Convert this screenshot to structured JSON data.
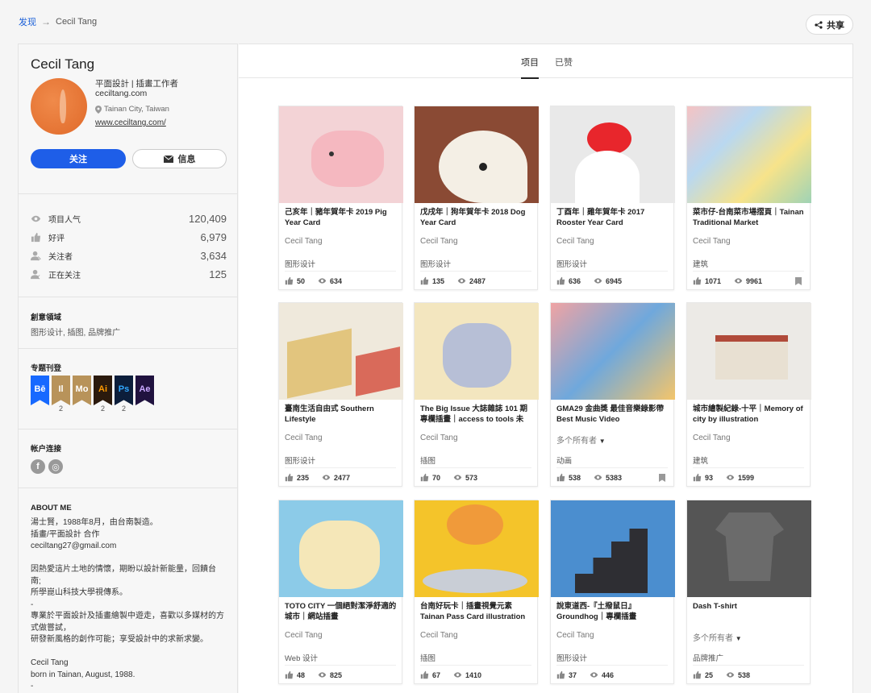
{
  "breadcrumb": {
    "root": "发现",
    "arrow": "→",
    "current": "Cecil Tang"
  },
  "share_label": "共享",
  "profile": {
    "name": "Cecil Tang",
    "role": "平面設計 | 插畫工作者",
    "site": "ceciltang.com",
    "location": "Tainan City, Taiwan",
    "url": "www.ceciltang.com/",
    "follow_label": "关注",
    "message_label": "信息"
  },
  "stats": [
    {
      "icon": "eye-icon",
      "label": "项目人气",
      "value": "120,409"
    },
    {
      "icon": "thumbs-up-icon",
      "label": "好评",
      "value": "6,979"
    },
    {
      "icon": "follower-icon",
      "label": "关注者",
      "value": "3,634"
    },
    {
      "icon": "following-icon",
      "label": "正在关注",
      "value": "125"
    }
  ],
  "creative_fields": {
    "title": "創意領域",
    "value": "图形设计, 插图, 品牌推广"
  },
  "featured": {
    "title": "专题刊登",
    "badges": [
      {
        "label": "Bē",
        "color": "#1769ff",
        "count": ""
      },
      {
        "label": "Il",
        "color": "#b8935a",
        "count": "2"
      },
      {
        "label": "Mo",
        "color": "#b8935a",
        "count": ""
      },
      {
        "label": "Ai",
        "color": "#2b1a0d",
        "count": "2"
      },
      {
        "label": "Ps",
        "color": "#0c1e3b",
        "count": "2"
      },
      {
        "label": "Ae",
        "color": "#20123f",
        "count": ""
      }
    ]
  },
  "accounts": {
    "title": "帐户连接",
    "icons": [
      "facebook-icon",
      "instagram-icon"
    ]
  },
  "about": {
    "title": "ABOUT ME",
    "lines": [
      "湯士賢，1988年8月，由台南製造。",
      "插畫/平面設計 合作",
      "ceciltang27@gmail.com",
      "",
      "因熱愛這片土地的情懷，期盼以設計新能量，回饋台",
      "南;",
      "所學崑山科技大學視傳系。",
      "-",
      "專業於平面設計及插畫繪製中遊走，喜歡以多媒材的方",
      "式做嘗試，",
      "研發新風格的創作可能；享受設計中的求新求變。",
      "",
      "Cecil Tang",
      "born in Tainan, August, 1988.",
      "-"
    ]
  },
  "tabs": [
    {
      "label": "项目",
      "active": true
    },
    {
      "label": "已赞",
      "active": false
    }
  ],
  "projects": [
    {
      "title": "己亥年｜豬年賀年卡 2019 Pig Year Card",
      "owner": "Cecil Tang",
      "field": "图形设计",
      "likes": "50",
      "views": "634",
      "bookmark": false,
      "thumb": "pig-illustration"
    },
    {
      "title": "戊戌年｜狗年賀年卡 2018 Dog Year Card",
      "owner": "Cecil Tang",
      "field": "图形设计",
      "likes": "135",
      "views": "2487",
      "bookmark": false,
      "thumb": "dog-illustration"
    },
    {
      "title": "丁酉年｜雞年賀年卡 2017 Rooster Year Card",
      "owner": "Cecil Tang",
      "field": "图形设计",
      "likes": "636",
      "views": "6945",
      "bookmark": false,
      "thumb": "rooster-illustration"
    },
    {
      "title": "菜市仔-台南菜市場摺頁｜Tainan Traditional Market",
      "owner": "Cecil Tang",
      "field": "建筑",
      "likes": "1071",
      "views": "9961",
      "bookmark": true,
      "thumb": "market-illustration"
    },
    {
      "title": "臺南生活自由式 Southern Lifestyle",
      "owner": "Cecil Tang",
      "field": "图形设计",
      "likes": "235",
      "views": "2477",
      "bookmark": false,
      "thumb": "street-illustration"
    },
    {
      "title": "The Big Issue 大誌雜誌 101 期 專欄插畫｜access to tools 未",
      "owner": "Cecil Tang",
      "field": "插图",
      "likes": "70",
      "views": "573",
      "bookmark": false,
      "thumb": "cable-car-illustration"
    },
    {
      "title": "GMA29 金曲獎 最佳音樂錄影帶 Best Music Video",
      "owner": "多个所有者",
      "field": "动画",
      "likes": "538",
      "views": "5383",
      "bookmark": true,
      "thumb": "music-video-illustration"
    },
    {
      "title": "城市繪製紀錄-十平｜Memory of city by illustration",
      "owner": "Cecil Tang",
      "field": "建筑",
      "likes": "93",
      "views": "1599",
      "bookmark": false,
      "thumb": "house-illustration"
    },
    {
      "title": "TOTO CITY 一個絕對潔淨舒適的城市｜網站插畫",
      "owner": "Cecil Tang",
      "field": "Web 设计",
      "likes": "48",
      "views": "825",
      "bookmark": false,
      "thumb": "city-map-illustration"
    },
    {
      "title": "台南好玩卡｜插畫視覺元素 Tainan Pass Card illustration",
      "owner": "Cecil Tang",
      "field": "插图",
      "likes": "67",
      "views": "1410",
      "bookmark": false,
      "thumb": "fish-illustration"
    },
    {
      "title": "說東道西-『土撥鼠日』 Groundhog｜專欄插畫",
      "owner": "Cecil Tang",
      "field": "图形设计",
      "likes": "37",
      "views": "446",
      "bookmark": false,
      "thumb": "stairs-illustration"
    },
    {
      "title": "Dash T-shirt",
      "owner": "多个所有者",
      "field": "品牌推广",
      "likes": "25",
      "views": "538",
      "bookmark": false,
      "thumb": "tshirt-photo"
    }
  ]
}
